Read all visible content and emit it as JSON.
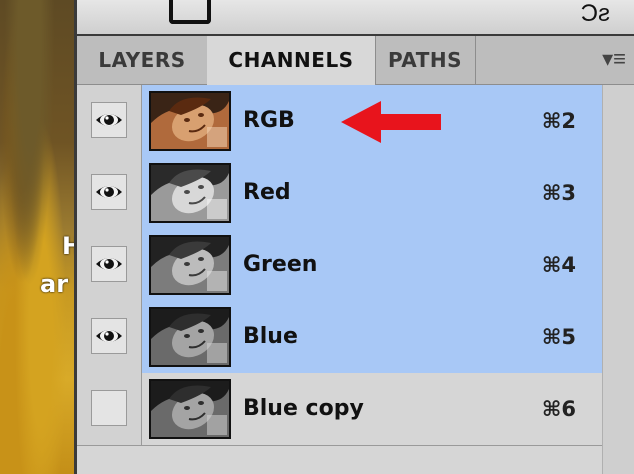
{
  "canvas": {
    "text_line1": "H",
    "text_line2": "ar"
  },
  "tabs": [
    {
      "label": "LAYERS",
      "active": false
    },
    {
      "label": "CHANNELS",
      "active": true
    },
    {
      "label": "PATHS",
      "active": false
    }
  ],
  "panel_menu_icon": "panel-menu-icon",
  "channels": [
    {
      "name": "RGB",
      "shortcut": "⌘2",
      "visible": true,
      "selected": true,
      "thumb": "color"
    },
    {
      "name": "Red",
      "shortcut": "⌘3",
      "visible": true,
      "selected": true,
      "thumb": "light"
    },
    {
      "name": "Green",
      "shortcut": "⌘4",
      "visible": true,
      "selected": true,
      "thumb": "mid"
    },
    {
      "name": "Blue",
      "shortcut": "⌘5",
      "visible": true,
      "selected": true,
      "thumb": "dark"
    },
    {
      "name": "Blue copy",
      "shortcut": "⌘6",
      "visible": false,
      "selected": false,
      "thumb": "dark"
    }
  ],
  "colors": {
    "selected_row": "#a8c8f6",
    "arrow": "#e8141c"
  }
}
